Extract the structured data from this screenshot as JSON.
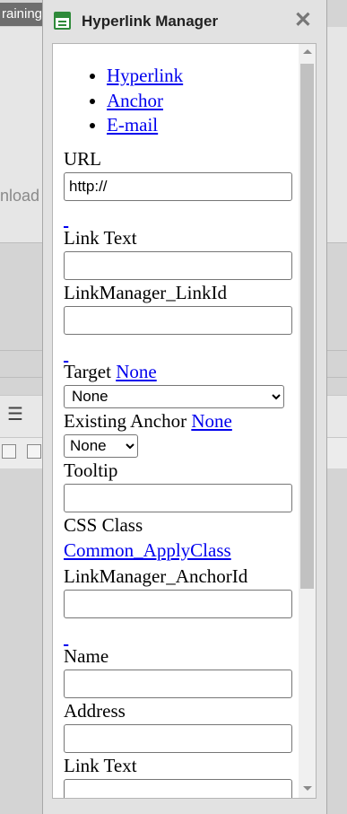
{
  "background": {
    "tab_label": "raining",
    "side_text": "nload"
  },
  "dialog": {
    "title": "Hyperlink Manager",
    "close_glyph": "✕",
    "tabs": [
      {
        "label": "Hyperlink"
      },
      {
        "label": "Anchor"
      },
      {
        "label": "E-mail"
      }
    ],
    "hyperlink": {
      "url_label": "URL",
      "url_value": "http://",
      "link_text_label": "Link Text",
      "link_text_value": "",
      "link_id_label": "LinkManager_LinkId",
      "link_id_value": "",
      "target_label": "Target",
      "target_link": "None",
      "target_select_value": "None",
      "existing_anchor_label": "Existing Anchor",
      "existing_anchor_link": "None",
      "existing_anchor_select_value": "None",
      "tooltip_label": "Tooltip",
      "tooltip_value": "",
      "css_class_label": "CSS Class",
      "css_class_link": "Common_ApplyClass",
      "anchor_id_label": "LinkManager_AnchorId",
      "anchor_id_value": ""
    },
    "anchor": {
      "name_label": "Name",
      "name_value": "",
      "address_label": "Address",
      "address_value": "",
      "link_text_label": "Link Text",
      "link_text_value": ""
    }
  },
  "colors": {
    "link": "#0000ee",
    "title_icon": "#2f8a3a"
  }
}
